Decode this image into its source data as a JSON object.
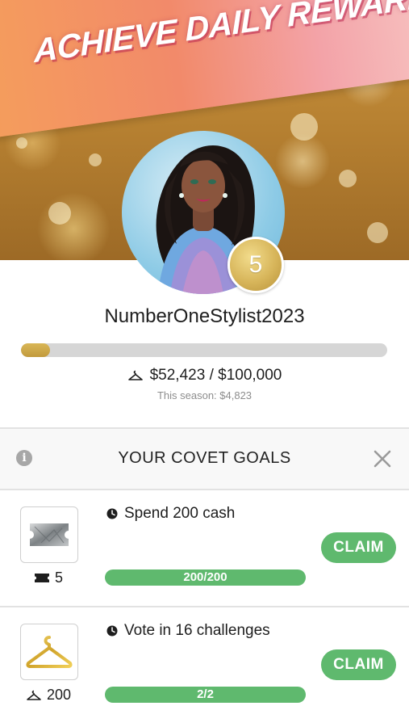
{
  "banner": {
    "title": "ACHIEVE DAILY REWARDS"
  },
  "profile": {
    "level": "5",
    "username": "NumberOneStylist2023",
    "progress_fraction": 0.08,
    "progress_text": "$52,423 / $100,000",
    "season_text": "This season: $4,823"
  },
  "goals_panel": {
    "title": "YOUR COVET GOALS",
    "info_icon": "info-icon",
    "close_icon": "close-icon",
    "goals": [
      {
        "description": "Spend 200 cash",
        "progress": "200/200",
        "progress_fraction": 1.0,
        "reward_icon": "ticket-icon",
        "reward_amount": "5",
        "thumb_icon": "silver-ticket-icon",
        "claim_label": "CLAIM"
      },
      {
        "description": "Vote in 16 challenges",
        "progress": "2/2",
        "progress_fraction": 1.0,
        "reward_icon": "hanger-icon",
        "reward_amount": "200",
        "thumb_icon": "gold-hanger-icon",
        "claim_label": "CLAIM"
      }
    ]
  },
  "colors": {
    "accent_green": "#5fb96e",
    "gold": "#c9a449",
    "track_gray": "#d6d6d6"
  }
}
